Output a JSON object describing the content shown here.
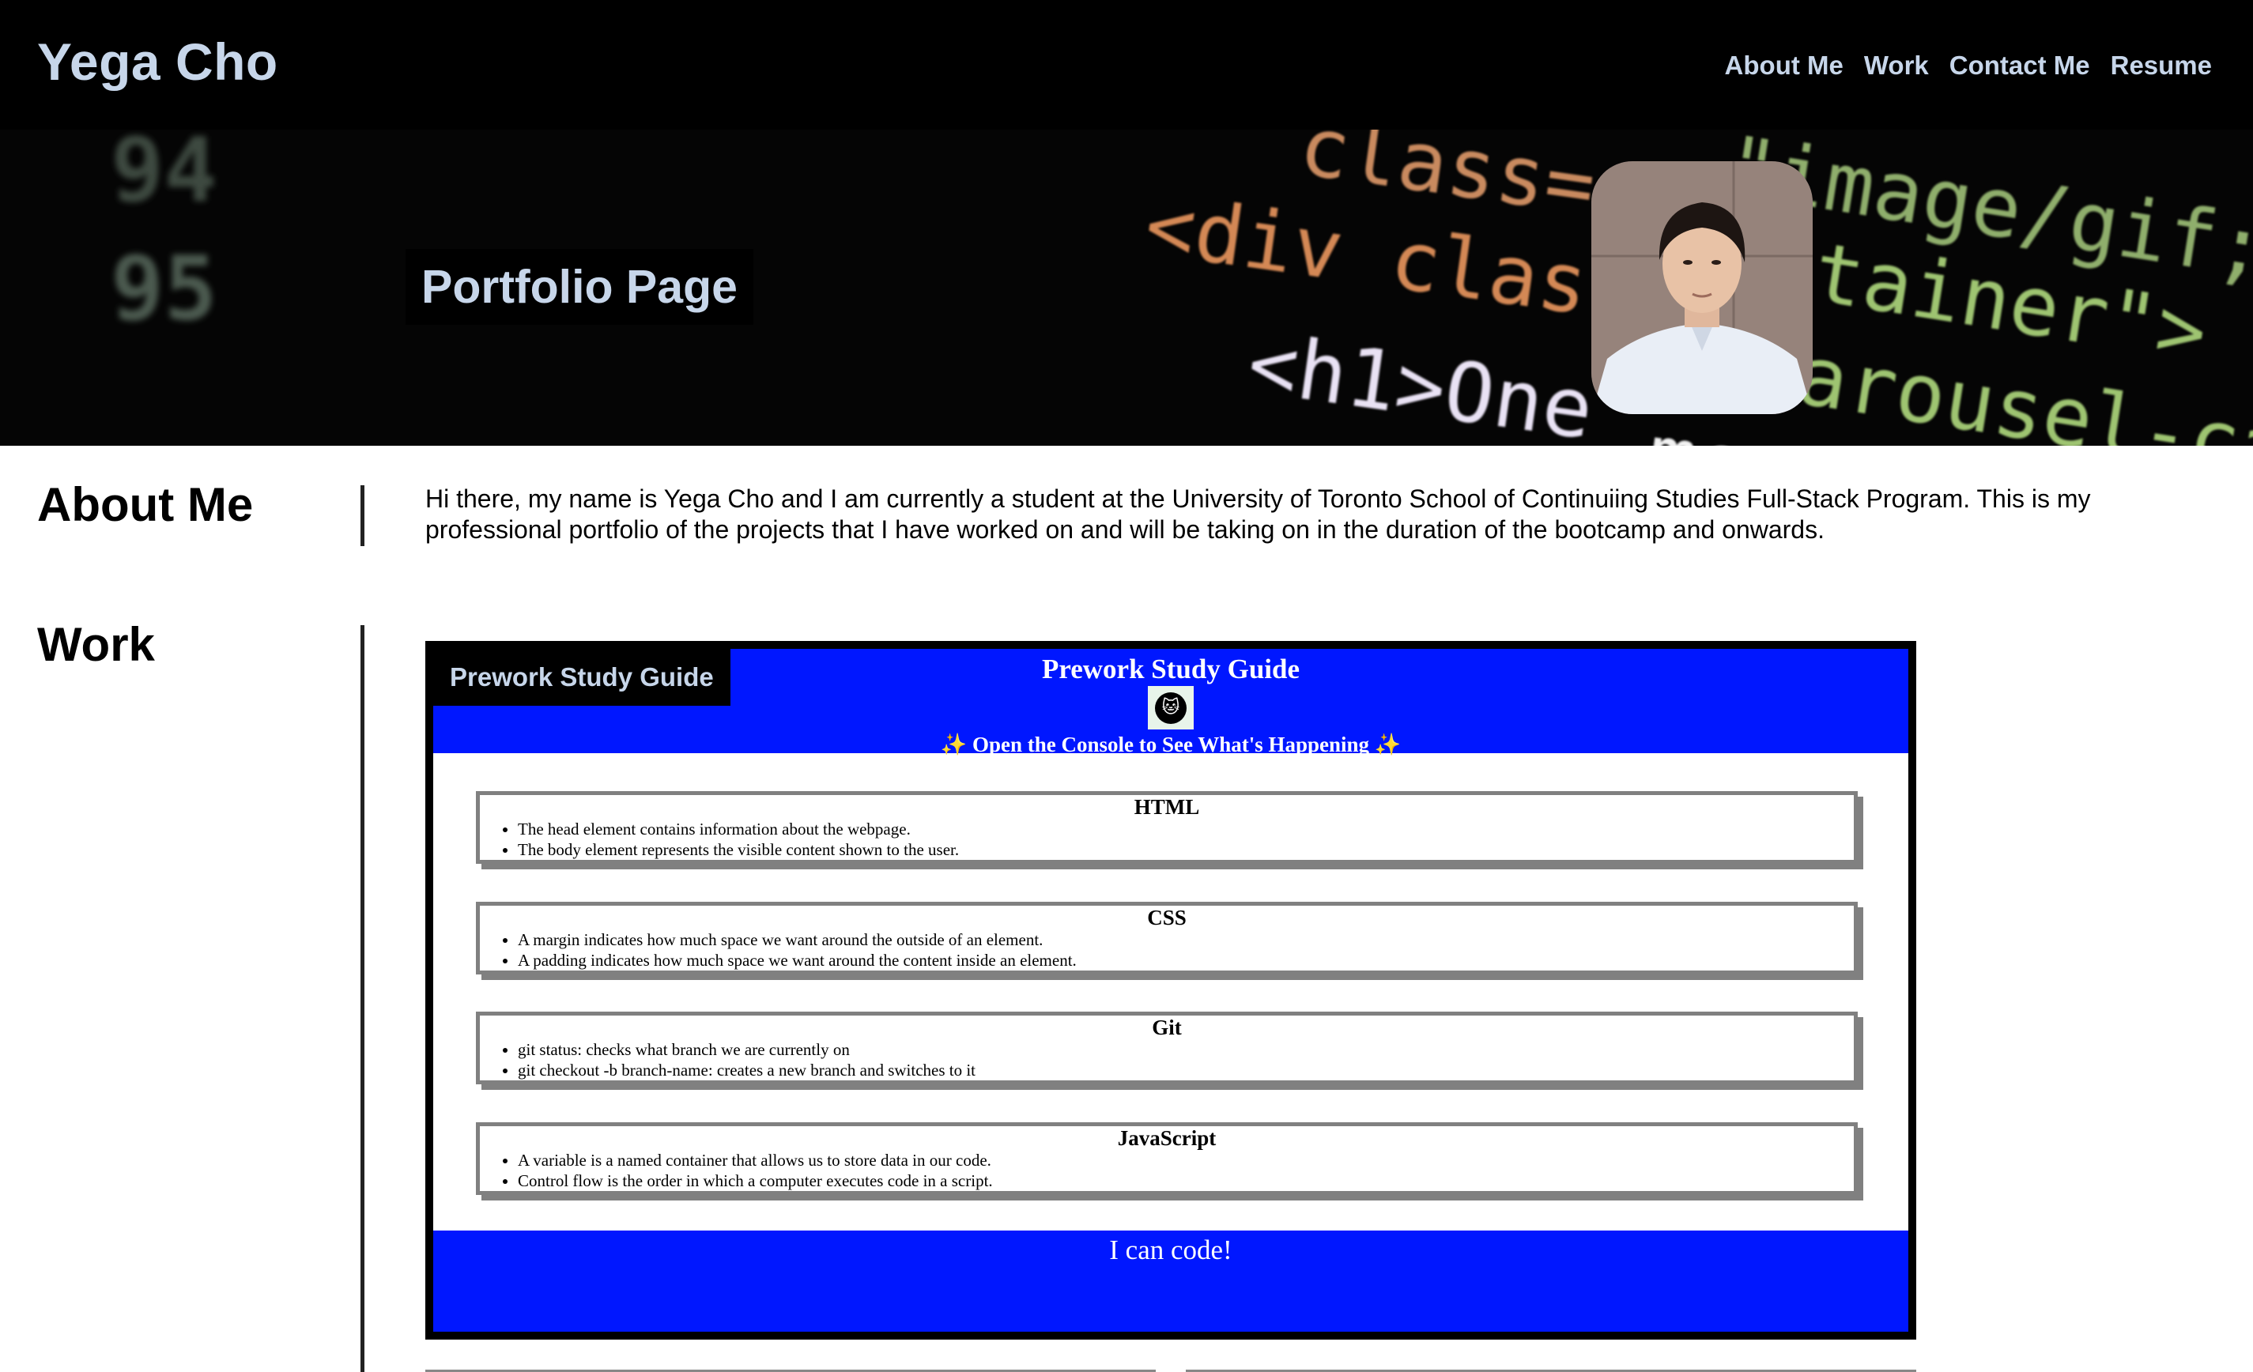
{
  "header": {
    "brand": "Yega Cho",
    "nav": [
      "About Me",
      "Work",
      "Contact Me",
      "Resume"
    ]
  },
  "hero": {
    "title": "Portfolio Page",
    "background_text": [
      "94",
      "95",
      "class=",
      "\"image/gif;b",
      "<div clas",
      "tainer\">",
      "<h1>One",
      "arousel-ca",
      "mone"
    ]
  },
  "about": {
    "heading": "About Me",
    "text": "Hi there, my name is Yega Cho and I am currently a student at the University of Toronto School of Continuiing Studies Full-Stack Program. This is my professional portfolio of the projects that I have worked on and will be taking on in the duration of the bootcamp and onwards."
  },
  "work": {
    "heading": "Work",
    "project": {
      "label": "Prework Study Guide",
      "title": "Prework Study Guide",
      "subtitle": "✨ Open the Console to See What's Happening ✨",
      "footer": "I can code!",
      "topics": [
        {
          "title": "HTML",
          "items": [
            "The head element contains information about the webpage.",
            "The body element represents the visible content shown to the user."
          ]
        },
        {
          "title": "CSS",
          "items": [
            "A margin indicates how much space we want around the outside of an element.",
            "A padding indicates how much space we want around the content inside an element."
          ]
        },
        {
          "title": "Git",
          "items": [
            "git status: checks what branch we are currently on",
            "git checkout -b branch-name: creates a new branch and switches to it"
          ]
        },
        {
          "title": "JavaScript",
          "items": [
            "A variable is a named container that allows us to store data in our code.",
            "Control flow is the order in which a computer executes code in a script."
          ]
        }
      ]
    }
  },
  "colors": {
    "header_bg": "#000000",
    "link": "#c7d6ea",
    "card_blue": "#0017ff",
    "topic_border": "#808080"
  }
}
